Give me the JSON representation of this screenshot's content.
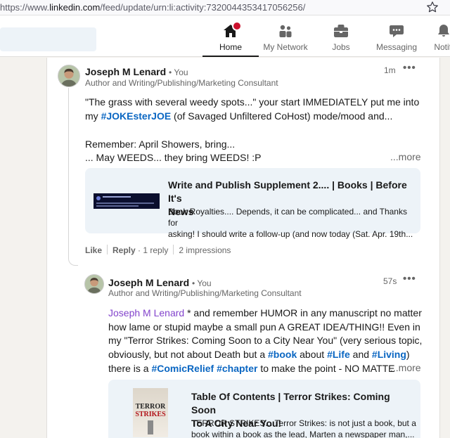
{
  "browser": {
    "url_prefix": "https://www.",
    "url_domain": "linkedin.com",
    "url_path": "/feed/update/urn:li:activity:7320044353417056256/"
  },
  "nav": {
    "items": [
      {
        "label": "Home",
        "icon": "home-icon",
        "active": true
      },
      {
        "label": "My Network",
        "icon": "network-icon"
      },
      {
        "label": "Jobs",
        "icon": "briefcase-icon"
      },
      {
        "label": "Messaging",
        "icon": "messaging-icon"
      },
      {
        "label": "Notifi",
        "icon": "bell-icon"
      }
    ]
  },
  "comment1": {
    "author": "Joseph M Lenard",
    "you": "• You",
    "headline": "Author and Writing/Publishing/Marketing Consultant",
    "time": "1m",
    "more_menu": "•••",
    "line1": "\"The grass with several weedy spots...\" your start IMMEDIATELY put me into",
    "line2_pre": "my ",
    "line2_tag": "#JOKEsterJOE",
    "line2_post": " (of Savaged Unfiltered CoHost) mode/mood and...",
    "line3": "Remember: April Showers, bring...",
    "line4": "... May WEEDS... they bring WEEDS! :P",
    "see_more": "...more",
    "preview": {
      "title_line1": "Write and Publish Supplement 2.... | Books | Before It's",
      "title_line2": "News",
      "desc_line1": "Book Royalties.... Depends, it can be complicated... and Thanks for",
      "desc_line2": "asking! I should write a follow-up (and now today (Sat. Apr. 19th..."
    },
    "actions": {
      "like": "Like",
      "reply": "Reply",
      "reply_count": "· 1 reply",
      "impressions": "2 impressions"
    }
  },
  "comment2": {
    "author": "Joseph M Lenard",
    "you": "• You",
    "headline": "Author and Writing/Publishing/Marketing Consultant",
    "time": "57s",
    "more_menu": "•••",
    "mention": "Joseph M Lenard",
    "line1_post": " * and remember HUMOR in any manuscript no matter",
    "line2": "how lame or stupid maybe a small pun A GREAT IDEA/THING!! Even in",
    "line3": "my \"Terror Strikes: Coming Soon to a City Near You\" (very serious topic,",
    "line4_pre": "obviously, but not about Death but a ",
    "line4_tag1": "#book",
    "line4_mid1": " about ",
    "line4_tag2": "#Life",
    "line4_mid2": " and ",
    "line4_tag3": "#Living",
    "line4_post": ")",
    "line5_pre": "there is a ",
    "line5_tag1": "#ComicRelief",
    "line5_mid": " ",
    "line5_tag2": "#chapter",
    "line5_post": " to make the point - NO MATTE",
    "see_more": "...more",
    "preview": {
      "title_line1": "Table Of Contents | Terror Strikes: Coming Soon",
      "title_line2": "To A City Near You!",
      "desc_line1": "TERROR STRIKES... Terror Strikes: is not just a book, but a",
      "desc_line2": "book within a book as the lead, Marten a newspaper man,...",
      "thumb_word1": "TERROR",
      "thumb_word2": "STRIKES"
    }
  },
  "colors": {
    "link_blue": "#0a66c2",
    "mention_purple": "#8344cc",
    "notification_red": "#cb112d",
    "preview_bg": "#edf3f8"
  }
}
